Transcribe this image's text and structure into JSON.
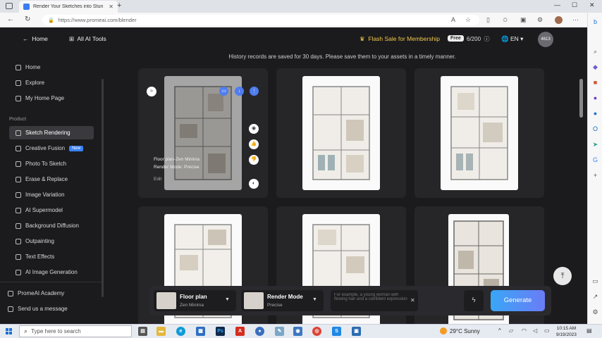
{
  "browser": {
    "tab_title": "Render Your Sketches into Stun",
    "url": "https://www.promeai.com/blender"
  },
  "topnav": {
    "home_label": "Home",
    "all_tools_label": "All AI Tools",
    "flash_sale": "Flash Sale for Membership",
    "free_badge": "Free",
    "credits": "6/200",
    "language": "EN",
    "avatar_text": "4613"
  },
  "sidebar": {
    "items": [
      {
        "label": "Home"
      },
      {
        "label": "Explore"
      },
      {
        "label": "My Home Page"
      }
    ],
    "section_product": "Product",
    "product_items": [
      {
        "label": "Sketch Rendering",
        "active": true
      },
      {
        "label": "Creative Fusion",
        "badge": "New"
      },
      {
        "label": "Photo To Sketch"
      },
      {
        "label": "Erase & Replace"
      },
      {
        "label": "Image Variation"
      },
      {
        "label": "AI Supermodel"
      },
      {
        "label": "Background Diffusion"
      },
      {
        "label": "Outpainting"
      },
      {
        "label": "Text Effects"
      },
      {
        "label": "AI Image Generation"
      }
    ],
    "footer_items": [
      {
        "label": "PromeAI Academy"
      },
      {
        "label": "Send us a message"
      }
    ]
  },
  "main": {
    "history_notice": "History records are saved for 30 days. Please save them to your assets in a timely manner.",
    "first_card": {
      "overlay_line1": "Floor plan-Zen Minima",
      "overlay_line2": "Render Mode: Precise",
      "edit_label": "Edit"
    }
  },
  "genbar": {
    "style_title": "Floor plan",
    "style_sub": "Zen Minima",
    "mode_title": "Render Mode",
    "mode_sub": "Precise",
    "prompt_placeholder": "For example, a young woman with flowing hair and a confident expression",
    "generate_label": "Generate"
  },
  "taskbar": {
    "search_placeholder": "Type here to search",
    "weather": "29°C  Sunny",
    "time": "10:15 AM",
    "date": "9/19/2023"
  }
}
